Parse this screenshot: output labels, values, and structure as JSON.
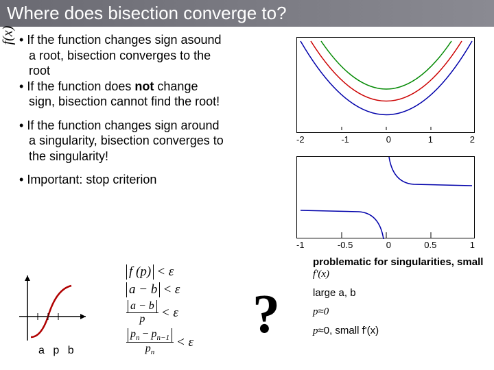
{
  "title": "Where does bisection converge to?",
  "bullets": {
    "b1": "If the function changes sign asound a root, bisection converges to the root",
    "b2a": "If the function does ",
    "b2b": "not",
    "b2c": " change sign, bisection cannot find the root!",
    "b3": "If the function changes sign around a singularity, bisection converges to the singularity!",
    "important": "Important: stop criterion"
  },
  "fx_label": "f(x)",
  "apb": "a p b",
  "formulas": {
    "f1_lhs": "f (p)",
    "lt_eps": "< ε",
    "f2_lhs": "a − b",
    "f3_num": "a − b",
    "f3_den": "p",
    "f4_num_a": "p",
    "f4_num_b": "p",
    "f4_sub1": "n",
    "f4_sub2": "n−1",
    "f4_den": "p",
    "f4_den_sub": "n"
  },
  "qmark": "?",
  "notes": {
    "n1a": "problematic for singularities, small ",
    "n1b": "f'(x)",
    "n2": "large a, b",
    "n3a": "p",
    "n3b": "≈",
    "n3c": "0",
    "n4a": "p",
    "n4b": "≈",
    "n4c": "0, small f'(x)"
  },
  "chart_data": [
    {
      "type": "line",
      "title": "",
      "xlabel": "",
      "ylabel": "",
      "xlim": [
        -2,
        2
      ],
      "ylim": [
        -1,
        3
      ],
      "categories": [
        -2,
        -1,
        0,
        1,
        2
      ],
      "series": [
        {
          "name": "blue",
          "color": "#0000aa",
          "x": [
            -2,
            -1.5,
            -1,
            -0.5,
            0,
            0.5,
            1,
            1.5,
            2
          ],
          "values": [
            3,
            1.25,
            0,
            -0.75,
            -1,
            -0.75,
            0,
            1.25,
            3
          ]
        },
        {
          "name": "red",
          "color": "#cc0000",
          "x": [
            -2,
            -1.5,
            -1,
            -0.5,
            0,
            0.5,
            1,
            1.5,
            2
          ],
          "values": [
            4,
            2.25,
            1,
            0.25,
            0,
            0.25,
            1,
            2.25,
            4
          ]
        },
        {
          "name": "green",
          "color": "#008800",
          "x": [
            -2,
            -1.5,
            -1,
            -0.5,
            0,
            0.5,
            1,
            1.5,
            2
          ],
          "values": [
            5,
            3.25,
            2,
            1.25,
            1,
            1.25,
            2,
            3.25,
            5
          ]
        }
      ],
      "ticks_x": [
        "-2",
        "-1",
        "0",
        "1",
        "2"
      ]
    },
    {
      "type": "line",
      "title": "",
      "xlabel": "",
      "ylabel": "",
      "xlim": [
        -1,
        1
      ],
      "ylim": [
        -10,
        10
      ],
      "series": [
        {
          "name": "hyper",
          "color": "#0000aa",
          "x": [
            -1,
            -0.5,
            -0.2,
            -0.1,
            -0.05,
            0.05,
            0.1,
            0.2,
            0.5,
            1
          ],
          "values": [
            -1,
            -2,
            -5,
            -10,
            -20,
            20,
            10,
            5,
            2,
            1
          ]
        }
      ],
      "ticks_x": [
        "-1",
        "-0.5",
        "0",
        "0.5",
        "1"
      ]
    }
  ]
}
